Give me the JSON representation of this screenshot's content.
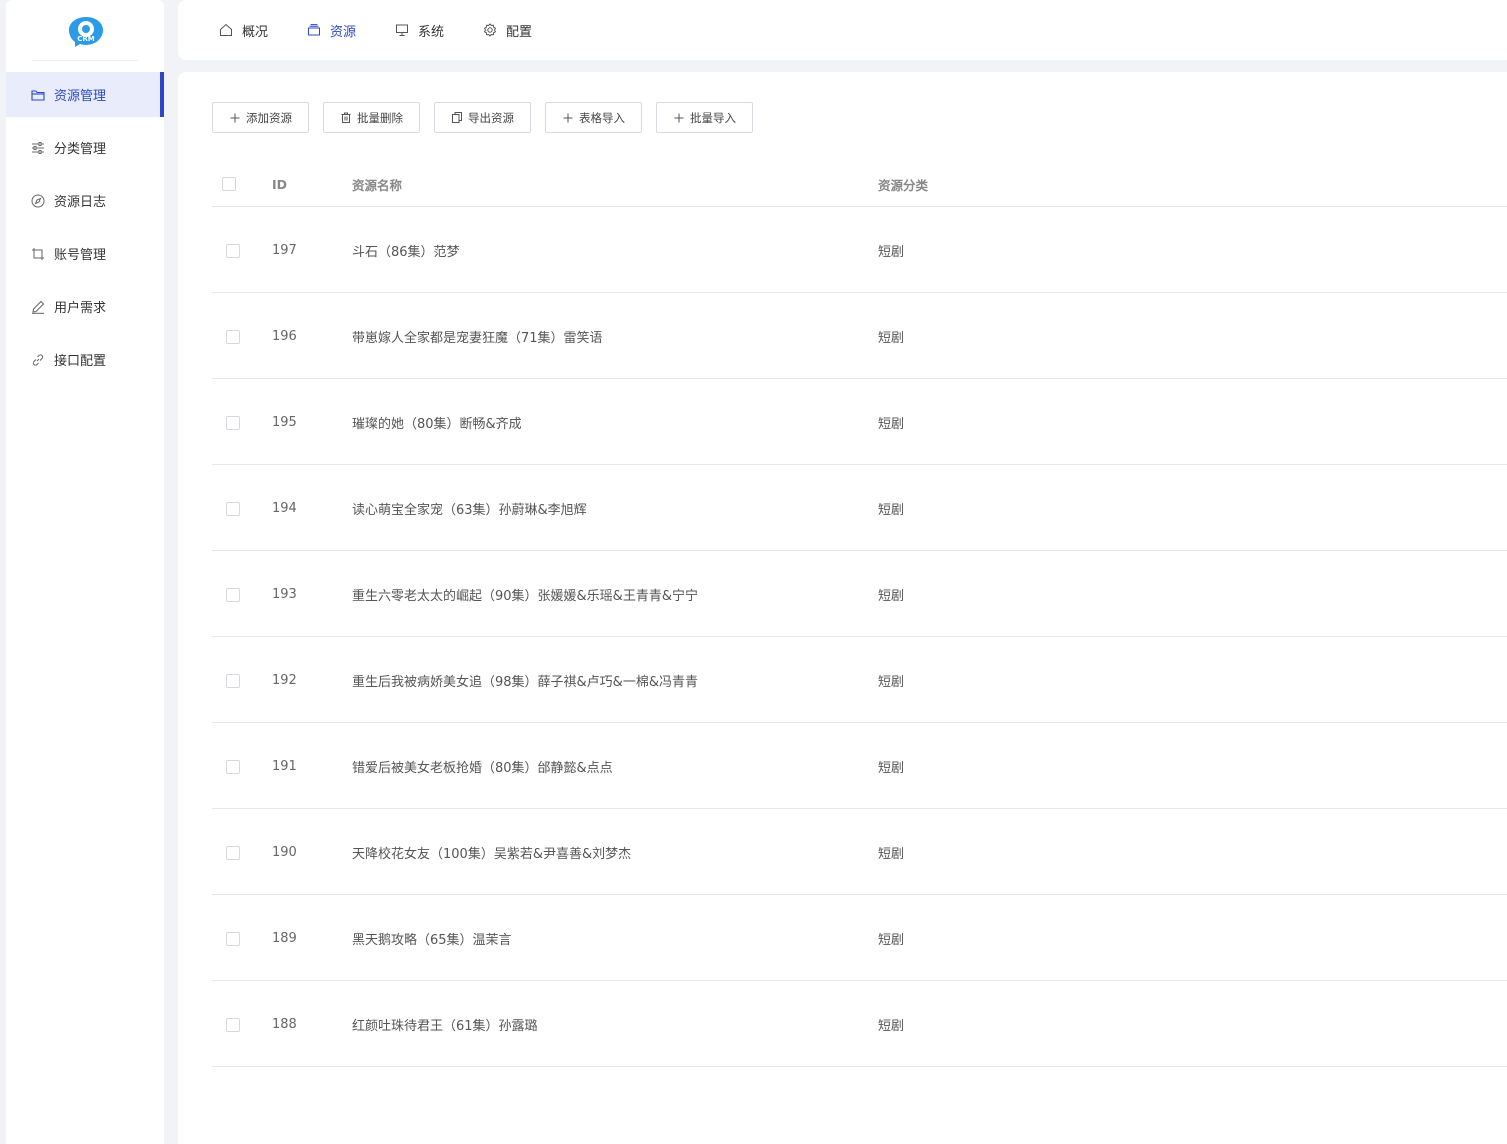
{
  "app": {
    "logo_text": "CRM",
    "accent_color": "#2b48c8"
  },
  "sidebar": {
    "items": [
      {
        "label": "资源管理",
        "icon": "folder-icon",
        "active": true
      },
      {
        "label": "分类管理",
        "icon": "sliders-icon",
        "active": false
      },
      {
        "label": "资源日志",
        "icon": "compass-icon",
        "active": false
      },
      {
        "label": "账号管理",
        "icon": "crop-icon",
        "active": false
      },
      {
        "label": "用户需求",
        "icon": "pen-icon",
        "active": false
      },
      {
        "label": "接口配置",
        "icon": "link-icon",
        "active": false
      }
    ]
  },
  "topnav": {
    "items": [
      {
        "label": "概况",
        "icon": "home-icon",
        "active": false
      },
      {
        "label": "资源",
        "icon": "layers-icon",
        "active": true
      },
      {
        "label": "系统",
        "icon": "monitor-icon",
        "active": false
      },
      {
        "label": "配置",
        "icon": "gear-icon",
        "active": false
      }
    ]
  },
  "toolbar": {
    "add": "添加资源",
    "batch_delete": "批量删除",
    "export": "导出资源",
    "table_import": "表格导入",
    "batch_import": "批量导入"
  },
  "table": {
    "headers": {
      "id": "ID",
      "name": "资源名称",
      "category": "资源分类"
    },
    "rows": [
      {
        "id": "197",
        "name": "斗石（86集）范梦",
        "category": "短剧"
      },
      {
        "id": "196",
        "name": "带崽嫁人全家都是宠妻狂魔（71集）雷笑语",
        "category": "短剧"
      },
      {
        "id": "195",
        "name": "璀璨的她（80集）断畅&齐成",
        "category": "短剧"
      },
      {
        "id": "194",
        "name": "读心萌宝全家宠（63集）孙蔚琳&李旭辉",
        "category": "短剧"
      },
      {
        "id": "193",
        "name": "重生六零老太太的崛起（90集）张媛媛&乐瑶&王青青&宁宁",
        "category": "短剧"
      },
      {
        "id": "192",
        "name": "重生后我被病娇美女追（98集）薛子祺&卢巧&一棉&冯青青",
        "category": "短剧"
      },
      {
        "id": "191",
        "name": "错爱后被美女老板抢婚（80集）邰静懿&点点",
        "category": "短剧"
      },
      {
        "id": "190",
        "name": "天降校花女友（100集）吴紫若&尹喜善&刘梦杰",
        "category": "短剧"
      },
      {
        "id": "189",
        "name": "黑天鹅攻略（65集）温茉言",
        "category": "短剧"
      },
      {
        "id": "188",
        "name": "红颜吐珠待君王（61集）孙露璐",
        "category": "短剧"
      }
    ]
  }
}
